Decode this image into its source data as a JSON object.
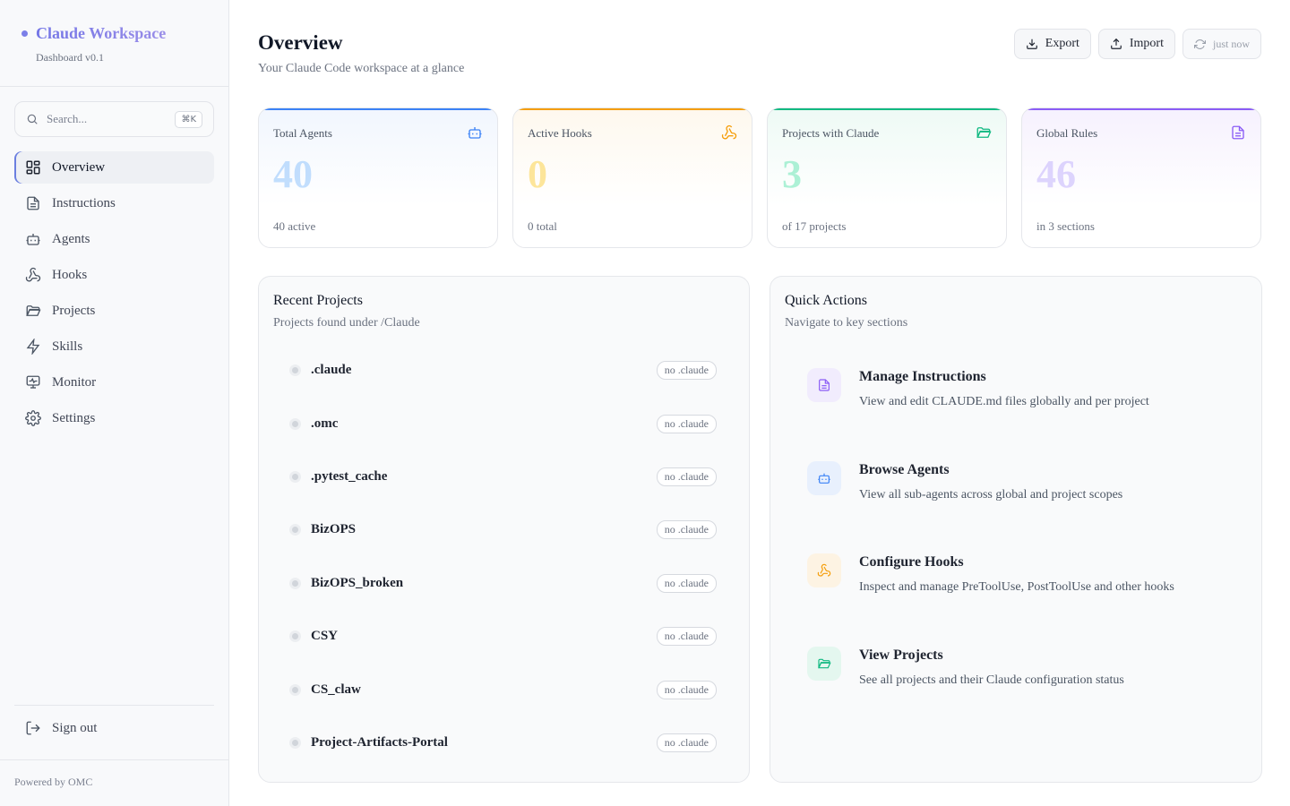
{
  "app": {
    "title": "Claude Workspace",
    "version": "Dashboard v0.1",
    "powered_by": "Powered by OMC",
    "brand_color": "#7b7fe8"
  },
  "search": {
    "placeholder": "Search...",
    "shortcut": "⌘K"
  },
  "sidebar": {
    "items": [
      {
        "label": "Overview",
        "icon": "grid-icon",
        "active": true
      },
      {
        "label": "Instructions",
        "icon": "document-icon"
      },
      {
        "label": "Agents",
        "icon": "robot-icon"
      },
      {
        "label": "Hooks",
        "icon": "webhook-icon"
      },
      {
        "label": "Projects",
        "icon": "folder-icon"
      },
      {
        "label": "Skills",
        "icon": "lightning-icon"
      },
      {
        "label": "Monitor",
        "icon": "monitor-icon"
      },
      {
        "label": "Settings",
        "icon": "gear-icon"
      }
    ],
    "signout": "Sign out"
  },
  "header": {
    "title": "Overview",
    "subtitle": "Your Claude Code workspace at a glance",
    "export_label": "Export",
    "import_label": "Import",
    "refresh_label": "just now"
  },
  "stats": [
    {
      "label": "Total Agents",
      "value": "40",
      "foot": "40 active",
      "color": "#3b82f6",
      "icon": "robot-icon"
    },
    {
      "label": "Active Hooks",
      "value": "0",
      "foot": "0 total",
      "color": "#f59e0b",
      "icon": "webhook-icon"
    },
    {
      "label": "Projects with Claude",
      "value": "3",
      "foot": "of 17 projects",
      "color": "#10b981",
      "icon": "folder-icon"
    },
    {
      "label": "Global Rules",
      "value": "46",
      "foot": "in 3 sections",
      "color": "#8b5cf6",
      "icon": "document-icon"
    }
  ],
  "recent_projects": {
    "title": "Recent Projects",
    "subtitle": "Projects found under /Claude",
    "items": [
      {
        "name": ".claude",
        "badge": "no .claude"
      },
      {
        "name": ".omc",
        "badge": "no .claude"
      },
      {
        "name": ".pytest_cache",
        "badge": "no .claude"
      },
      {
        "name": "BizOPS",
        "badge": "no .claude"
      },
      {
        "name": "BizOPS_broken",
        "badge": "no .claude"
      },
      {
        "name": "CSY",
        "badge": "no .claude"
      },
      {
        "name": "CS_claw",
        "badge": "no .claude"
      },
      {
        "name": "Project-Artifacts-Portal",
        "badge": "no .claude"
      }
    ]
  },
  "quick_actions": {
    "title": "Quick Actions",
    "subtitle": "Navigate to key sections",
    "items": [
      {
        "title": "Manage Instructions",
        "desc": "View and edit CLAUDE.md files globally and per project",
        "color": "#8b5cf6",
        "bg": "#f1ecfd",
        "icon": "document-icon"
      },
      {
        "title": "Browse Agents",
        "desc": "View all sub-agents across global and project scopes",
        "color": "#3b82f6",
        "bg": "#e8f0fd",
        "icon": "robot-icon"
      },
      {
        "title": "Configure Hooks",
        "desc": "Inspect and manage PreToolUse, PostToolUse and other hooks",
        "color": "#f59e0b",
        "bg": "#fdf3e3",
        "icon": "webhook-icon"
      },
      {
        "title": "View Projects",
        "desc": "See all projects and their Claude configuration status",
        "color": "#10b981",
        "bg": "#e4f7ef",
        "icon": "folder-icon"
      }
    ]
  }
}
